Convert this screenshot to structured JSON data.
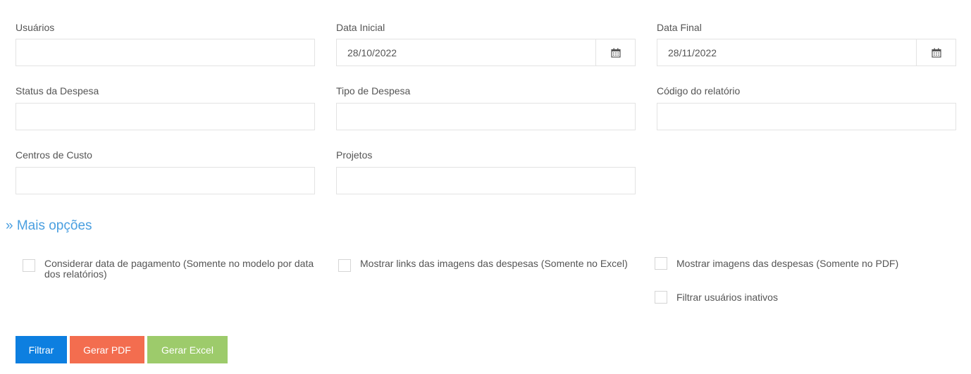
{
  "filters": {
    "usuarios_label": "Usuários",
    "data_inicial_label": "Data Inicial",
    "data_inicial_value": "28/10/2022",
    "data_final_label": "Data Final",
    "data_final_value": "28/11/2022",
    "status_label": "Status da Despesa",
    "tipo_label": "Tipo de Despesa",
    "codigo_label": "Código do relatório",
    "centros_label": "Centros de Custo",
    "projetos_label": "Projetos"
  },
  "more_options": {
    "label": "» Mais opções"
  },
  "options": [
    {
      "label": "Considerar data de pagamento (Somente no modelo por data dos relatórios)",
      "checked": false
    },
    {
      "label": "Mostrar links das imagens das despesas (Somente no Excel)",
      "checked": false
    },
    {
      "label": "Mostrar imagens das despesas (Somente no PDF)",
      "checked": false
    },
    {
      "label": "Filtrar usuários inativos",
      "checked": false
    }
  ],
  "actions": {
    "filtrar": "Filtrar",
    "gerar_pdf": "Gerar PDF",
    "gerar_excel": "Gerar Excel"
  },
  "colors": {
    "filtrar": "#0d7fe0",
    "gerar_pdf": "#f36d4f",
    "gerar_excel": "#9dcb6b",
    "link": "#4a9fe0"
  },
  "icons": {
    "calendar": "calendar-icon"
  }
}
